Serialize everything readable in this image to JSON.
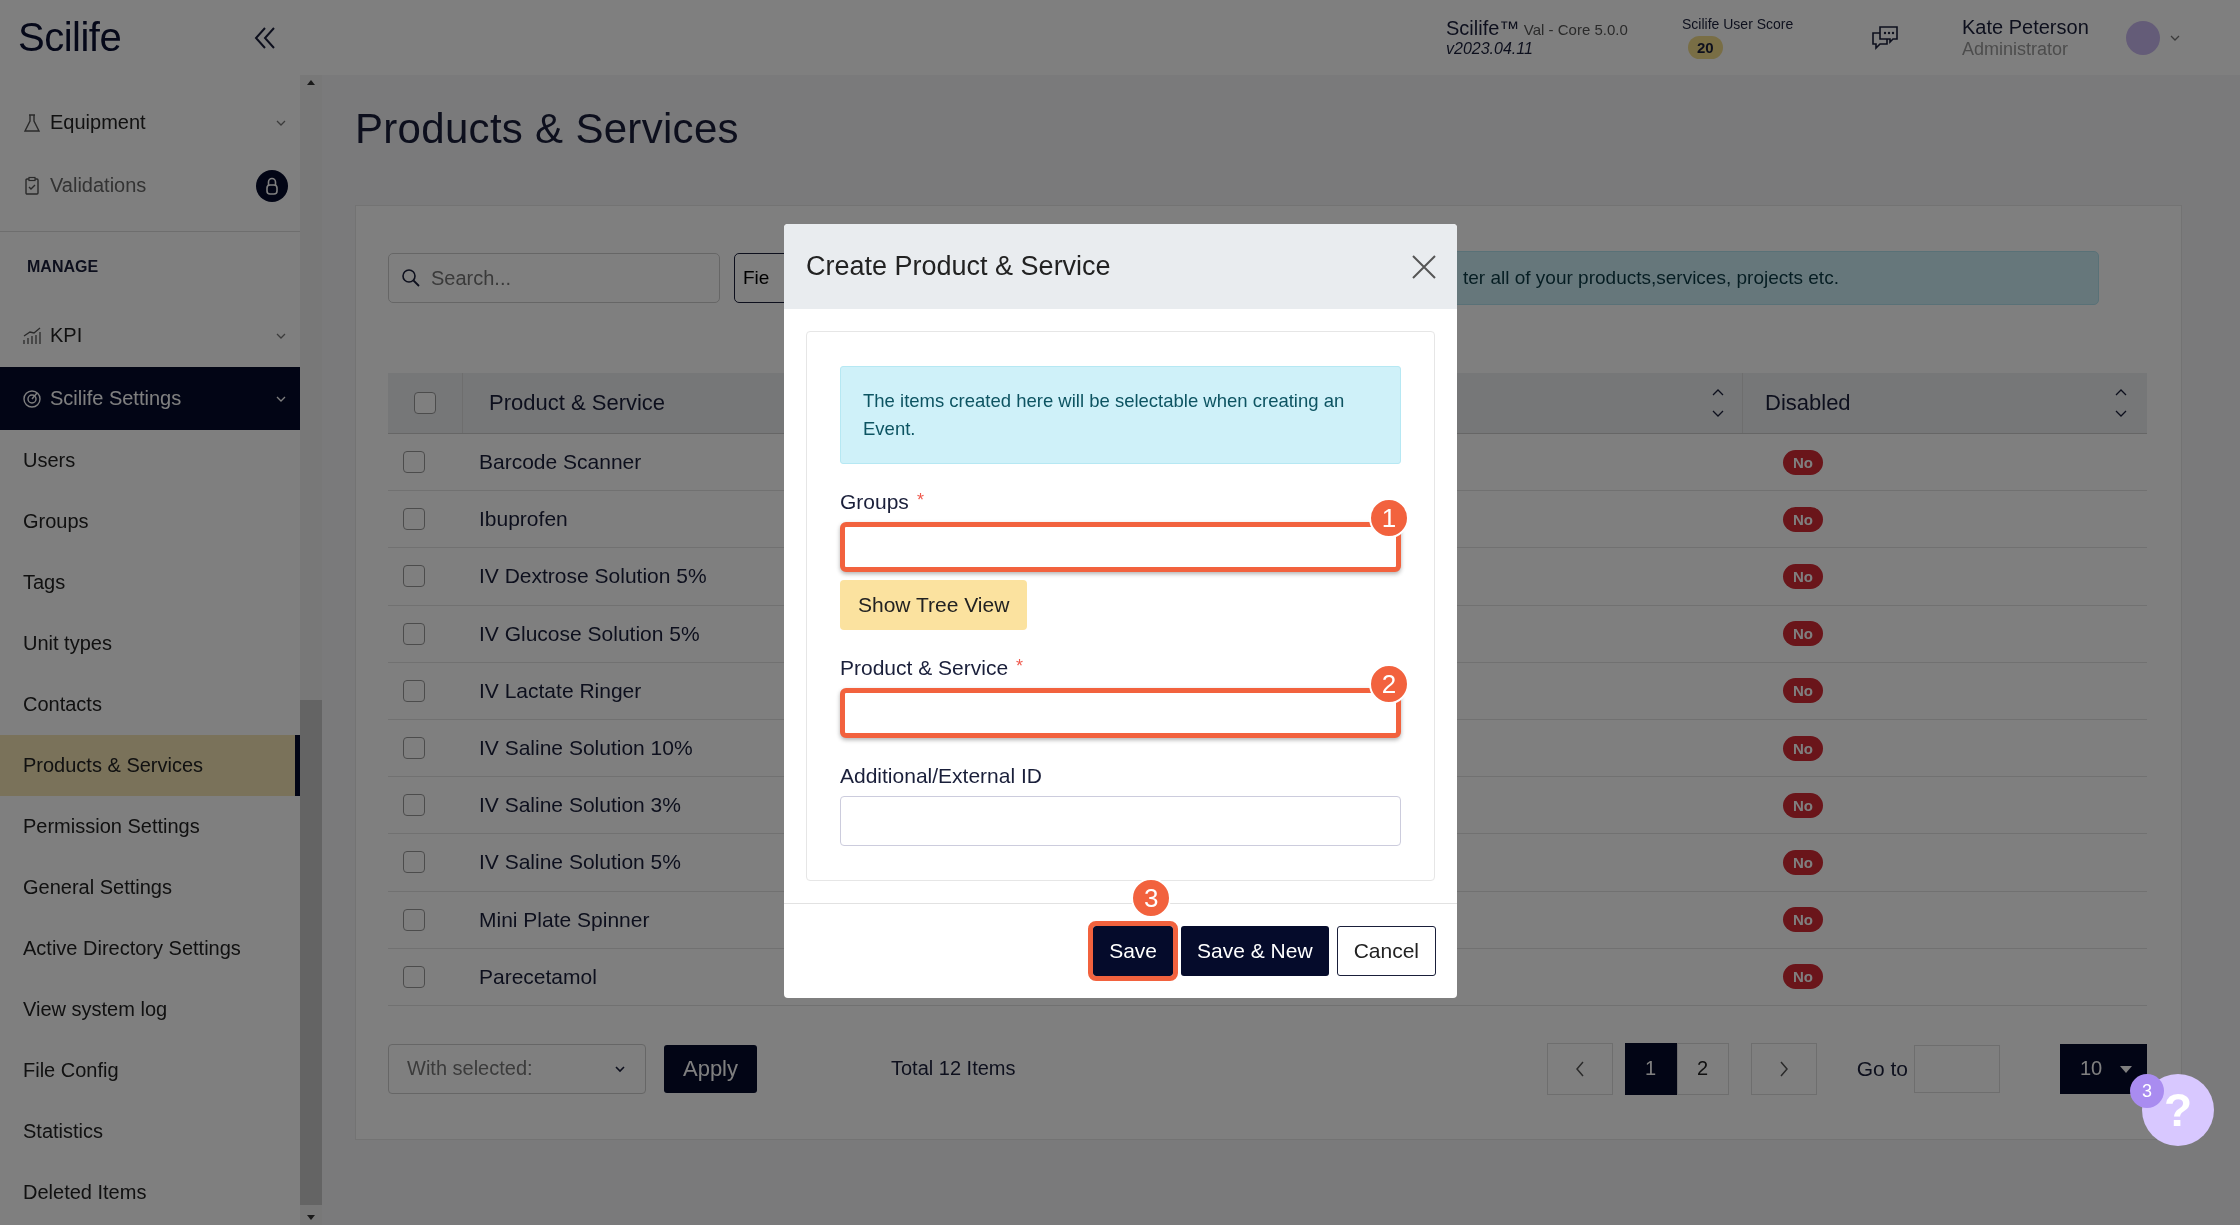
{
  "header": {
    "product": "Scilife™",
    "edition": "Val - Core 5.0.0",
    "version": "v2023.04.11",
    "score_label": "Scilife User Score",
    "score": "20",
    "user_name": "Kate Peterson",
    "user_role": "Administrator"
  },
  "sidebar": {
    "logo": "Scilife",
    "items": [
      {
        "label": "Equipment",
        "expandable": true,
        "locked": false
      },
      {
        "label": "Validations",
        "expandable": false,
        "locked": true
      }
    ],
    "section": "MANAGE",
    "groups": [
      {
        "label": "KPI",
        "selected": false
      },
      {
        "label": "Scilife Settings",
        "selected": true,
        "children": [
          {
            "label": "Users",
            "selected": false
          },
          {
            "label": "Groups",
            "selected": false
          },
          {
            "label": "Tags",
            "selected": false
          },
          {
            "label": "Unit types",
            "selected": false
          },
          {
            "label": "Contacts",
            "selected": false
          },
          {
            "label": "Products & Services",
            "selected": true
          },
          {
            "label": "Permission Settings",
            "selected": false
          },
          {
            "label": "General Settings",
            "selected": false
          },
          {
            "label": "Active Directory Settings",
            "selected": false
          },
          {
            "label": "View system log",
            "selected": false
          },
          {
            "label": "File Config",
            "selected": false
          },
          {
            "label": "Statistics",
            "selected": false
          },
          {
            "label": "Deleted Items",
            "selected": false
          }
        ]
      }
    ]
  },
  "page": {
    "title": "Products & Services",
    "search": {
      "placeholder": "Search..."
    },
    "filter_button": "Fie",
    "info_banner": "ter all of your products,services, projects etc.",
    "select_all": {
      "checked": false
    },
    "columns": [
      {
        "label": "Product & Service"
      },
      {
        "sortable": true
      },
      {
        "label": "Disabled",
        "sortable": true
      }
    ],
    "rows": [
      {
        "name": "Barcode Scanner",
        "checked": false,
        "disabled": "No"
      },
      {
        "name": "Ibuprofen",
        "checked": false,
        "disabled": "No"
      },
      {
        "name": "IV Dextrose Solution 5%",
        "checked": false,
        "disabled": "No"
      },
      {
        "name": "IV Glucose Solution 5%",
        "checked": false,
        "disabled": "No"
      },
      {
        "name": "IV Lactate Ringer",
        "checked": false,
        "disabled": "No"
      },
      {
        "name": "IV Saline Solution 10%",
        "checked": false,
        "disabled": "No"
      },
      {
        "name": "IV Saline Solution 3%",
        "checked": false,
        "disabled": "No"
      },
      {
        "name": "IV Saline Solution 5%",
        "checked": false,
        "disabled": "No"
      },
      {
        "name": "Mini Plate Spinner",
        "checked": false,
        "disabled": "No"
      },
      {
        "name": "Parecetamol",
        "checked": false,
        "disabled": "No"
      }
    ],
    "bulk_action": {
      "placeholder": "With selected:"
    },
    "apply": "Apply",
    "total": "Total 12 Items",
    "pages": [
      {
        "label": "1",
        "selected": true
      },
      {
        "label": "2",
        "selected": false
      }
    ],
    "goto_label": "Go to",
    "page_size": "10"
  },
  "help": {
    "label": "?",
    "badge": "3"
  },
  "modal": {
    "title": "Create Product & Service",
    "alert": "The items created here will be selectable when creating an Event.",
    "required_mark": "*",
    "fields": [
      {
        "label": "Groups",
        "required": true,
        "callout": "1",
        "tree_button": "Show Tree View"
      },
      {
        "label": "Product & Service",
        "required": true,
        "callout": "2"
      },
      {
        "label": "Additional/External ID",
        "required": false
      }
    ],
    "buttons": [
      {
        "label": "Save",
        "kind": "primary",
        "callout": "3"
      },
      {
        "label": "Save & New",
        "kind": "primary"
      },
      {
        "label": "Cancel",
        "kind": "secondary"
      }
    ]
  }
}
